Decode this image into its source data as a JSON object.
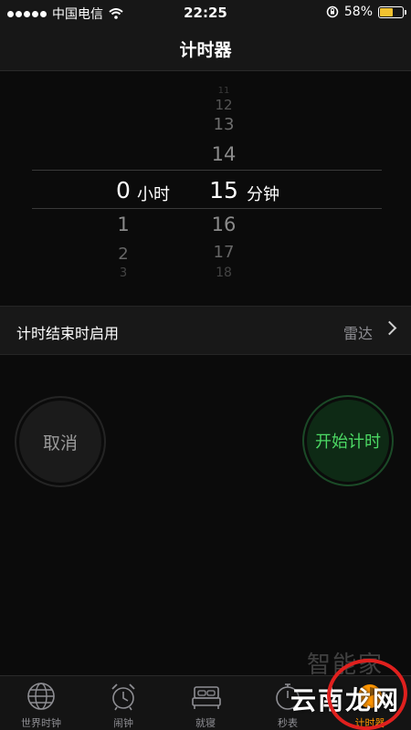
{
  "status_bar": {
    "carrier": "中国电信",
    "time": "22:25",
    "battery_percent": "58%",
    "battery_level": 0.58
  },
  "nav": {
    "title": "计时器"
  },
  "picker": {
    "hours_above": [
      "",
      "",
      ""
    ],
    "hours_selected": "0",
    "hours_unit": "小时",
    "hours_below": [
      "1",
      "2",
      "3"
    ],
    "minutes_above": [
      "11",
      "12",
      "13",
      "14"
    ],
    "minutes_selected": "15",
    "minutes_unit": "分钟",
    "minutes_below": [
      "16",
      "17",
      "18"
    ]
  },
  "option": {
    "label": "计时结束时启用",
    "value": "雷达"
  },
  "buttons": {
    "cancel": "取消",
    "start": "开始计时"
  },
  "tabs": [
    {
      "label": "世界时钟",
      "icon": "globe-icon"
    },
    {
      "label": "闹钟",
      "icon": "alarm-clock-icon"
    },
    {
      "label": "就寝",
      "icon": "bed-icon"
    },
    {
      "label": "秒表",
      "icon": "stopwatch-icon"
    },
    {
      "label": "计时器",
      "icon": "timer-icon",
      "active": true
    }
  ],
  "watermark": {
    "top": "智能家",
    "bottom": "云南龙网"
  },
  "colors": {
    "accent": "#ff9500",
    "start_green": "#4cd964",
    "battery": "#f2c230"
  }
}
